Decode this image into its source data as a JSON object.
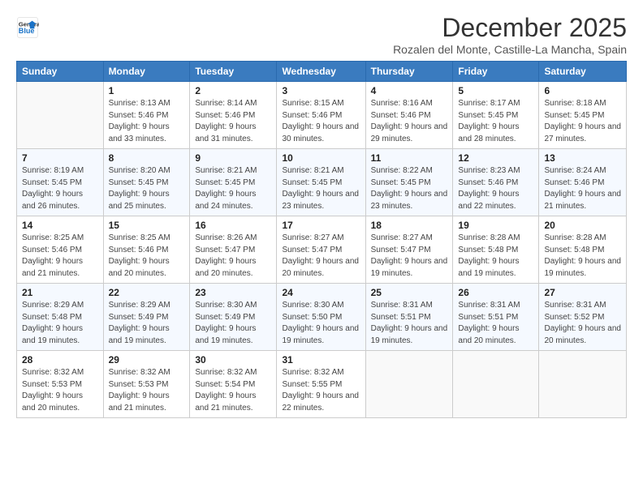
{
  "header": {
    "logo_line1": "General",
    "logo_line2": "Blue",
    "title": "December 2025",
    "subtitle": "Rozalen del Monte, Castille-La Mancha, Spain"
  },
  "weekdays": [
    "Sunday",
    "Monday",
    "Tuesday",
    "Wednesday",
    "Thursday",
    "Friday",
    "Saturday"
  ],
  "weeks": [
    [
      {
        "day": "",
        "sunrise": "",
        "sunset": "",
        "daylight": ""
      },
      {
        "day": "1",
        "sunrise": "Sunrise: 8:13 AM",
        "sunset": "Sunset: 5:46 PM",
        "daylight": "Daylight: 9 hours and 33 minutes."
      },
      {
        "day": "2",
        "sunrise": "Sunrise: 8:14 AM",
        "sunset": "Sunset: 5:46 PM",
        "daylight": "Daylight: 9 hours and 31 minutes."
      },
      {
        "day": "3",
        "sunrise": "Sunrise: 8:15 AM",
        "sunset": "Sunset: 5:46 PM",
        "daylight": "Daylight: 9 hours and 30 minutes."
      },
      {
        "day": "4",
        "sunrise": "Sunrise: 8:16 AM",
        "sunset": "Sunset: 5:46 PM",
        "daylight": "Daylight: 9 hours and 29 minutes."
      },
      {
        "day": "5",
        "sunrise": "Sunrise: 8:17 AM",
        "sunset": "Sunset: 5:45 PM",
        "daylight": "Daylight: 9 hours and 28 minutes."
      },
      {
        "day": "6",
        "sunrise": "Sunrise: 8:18 AM",
        "sunset": "Sunset: 5:45 PM",
        "daylight": "Daylight: 9 hours and 27 minutes."
      }
    ],
    [
      {
        "day": "7",
        "sunrise": "Sunrise: 8:19 AM",
        "sunset": "Sunset: 5:45 PM",
        "daylight": "Daylight: 9 hours and 26 minutes."
      },
      {
        "day": "8",
        "sunrise": "Sunrise: 8:20 AM",
        "sunset": "Sunset: 5:45 PM",
        "daylight": "Daylight: 9 hours and 25 minutes."
      },
      {
        "day": "9",
        "sunrise": "Sunrise: 8:21 AM",
        "sunset": "Sunset: 5:45 PM",
        "daylight": "Daylight: 9 hours and 24 minutes."
      },
      {
        "day": "10",
        "sunrise": "Sunrise: 8:21 AM",
        "sunset": "Sunset: 5:45 PM",
        "daylight": "Daylight: 9 hours and 23 minutes."
      },
      {
        "day": "11",
        "sunrise": "Sunrise: 8:22 AM",
        "sunset": "Sunset: 5:45 PM",
        "daylight": "Daylight: 9 hours and 23 minutes."
      },
      {
        "day": "12",
        "sunrise": "Sunrise: 8:23 AM",
        "sunset": "Sunset: 5:46 PM",
        "daylight": "Daylight: 9 hours and 22 minutes."
      },
      {
        "day": "13",
        "sunrise": "Sunrise: 8:24 AM",
        "sunset": "Sunset: 5:46 PM",
        "daylight": "Daylight: 9 hours and 21 minutes."
      }
    ],
    [
      {
        "day": "14",
        "sunrise": "Sunrise: 8:25 AM",
        "sunset": "Sunset: 5:46 PM",
        "daylight": "Daylight: 9 hours and 21 minutes."
      },
      {
        "day": "15",
        "sunrise": "Sunrise: 8:25 AM",
        "sunset": "Sunset: 5:46 PM",
        "daylight": "Daylight: 9 hours and 20 minutes."
      },
      {
        "day": "16",
        "sunrise": "Sunrise: 8:26 AM",
        "sunset": "Sunset: 5:47 PM",
        "daylight": "Daylight: 9 hours and 20 minutes."
      },
      {
        "day": "17",
        "sunrise": "Sunrise: 8:27 AM",
        "sunset": "Sunset: 5:47 PM",
        "daylight": "Daylight: 9 hours and 20 minutes."
      },
      {
        "day": "18",
        "sunrise": "Sunrise: 8:27 AM",
        "sunset": "Sunset: 5:47 PM",
        "daylight": "Daylight: 9 hours and 19 minutes."
      },
      {
        "day": "19",
        "sunrise": "Sunrise: 8:28 AM",
        "sunset": "Sunset: 5:48 PM",
        "daylight": "Daylight: 9 hours and 19 minutes."
      },
      {
        "day": "20",
        "sunrise": "Sunrise: 8:28 AM",
        "sunset": "Sunset: 5:48 PM",
        "daylight": "Daylight: 9 hours and 19 minutes."
      }
    ],
    [
      {
        "day": "21",
        "sunrise": "Sunrise: 8:29 AM",
        "sunset": "Sunset: 5:48 PM",
        "daylight": "Daylight: 9 hours and 19 minutes."
      },
      {
        "day": "22",
        "sunrise": "Sunrise: 8:29 AM",
        "sunset": "Sunset: 5:49 PM",
        "daylight": "Daylight: 9 hours and 19 minutes."
      },
      {
        "day": "23",
        "sunrise": "Sunrise: 8:30 AM",
        "sunset": "Sunset: 5:49 PM",
        "daylight": "Daylight: 9 hours and 19 minutes."
      },
      {
        "day": "24",
        "sunrise": "Sunrise: 8:30 AM",
        "sunset": "Sunset: 5:50 PM",
        "daylight": "Daylight: 9 hours and 19 minutes."
      },
      {
        "day": "25",
        "sunrise": "Sunrise: 8:31 AM",
        "sunset": "Sunset: 5:51 PM",
        "daylight": "Daylight: 9 hours and 19 minutes."
      },
      {
        "day": "26",
        "sunrise": "Sunrise: 8:31 AM",
        "sunset": "Sunset: 5:51 PM",
        "daylight": "Daylight: 9 hours and 20 minutes."
      },
      {
        "day": "27",
        "sunrise": "Sunrise: 8:31 AM",
        "sunset": "Sunset: 5:52 PM",
        "daylight": "Daylight: 9 hours and 20 minutes."
      }
    ],
    [
      {
        "day": "28",
        "sunrise": "Sunrise: 8:32 AM",
        "sunset": "Sunset: 5:53 PM",
        "daylight": "Daylight: 9 hours and 20 minutes."
      },
      {
        "day": "29",
        "sunrise": "Sunrise: 8:32 AM",
        "sunset": "Sunset: 5:53 PM",
        "daylight": "Daylight: 9 hours and 21 minutes."
      },
      {
        "day": "30",
        "sunrise": "Sunrise: 8:32 AM",
        "sunset": "Sunset: 5:54 PM",
        "daylight": "Daylight: 9 hours and 21 minutes."
      },
      {
        "day": "31",
        "sunrise": "Sunrise: 8:32 AM",
        "sunset": "Sunset: 5:55 PM",
        "daylight": "Daylight: 9 hours and 22 minutes."
      },
      {
        "day": "",
        "sunrise": "",
        "sunset": "",
        "daylight": ""
      },
      {
        "day": "",
        "sunrise": "",
        "sunset": "",
        "daylight": ""
      },
      {
        "day": "",
        "sunrise": "",
        "sunset": "",
        "daylight": ""
      }
    ]
  ]
}
